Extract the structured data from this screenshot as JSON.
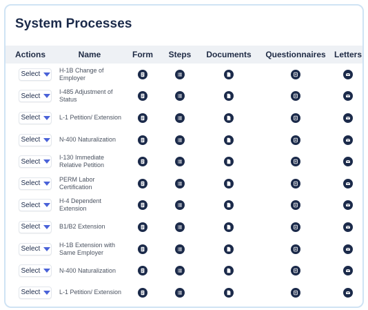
{
  "page": {
    "title": "System Processes"
  },
  "colors": {
    "accent": "#4a62d8",
    "icon_bg": "#1b2a4a",
    "header_bg": "#eef1f5",
    "border": "#cfe3f4"
  },
  "table": {
    "headers": {
      "actions": "Actions",
      "name": "Name",
      "form": "Form",
      "steps": "Steps",
      "documents": "Documents",
      "questionnaires": "Questionnaires",
      "letters": "Letters"
    },
    "row_icons": {
      "form": "form-icon",
      "steps": "list-icon",
      "documents": "document-icon",
      "questionnaires": "questionnaire-icon",
      "letters": "mail-icon"
    },
    "rows": [
      {
        "action": "Select",
        "name": "H-1B Change of Employer"
      },
      {
        "action": "Select",
        "name": "I-485 Adjustment of Status"
      },
      {
        "action": "Select",
        "name": "L-1 Petition/ Extension"
      },
      {
        "action": "Select",
        "name": "N-400 Naturalization"
      },
      {
        "action": "Select",
        "name": "I-130 Immediate Relative Petition"
      },
      {
        "action": "Select",
        "name": "PERM Labor Certification"
      },
      {
        "action": "Select",
        "name": "H-4 Dependent Extension"
      },
      {
        "action": "Select",
        "name": "B1/B2 Extension"
      },
      {
        "action": "Select",
        "name": "H-1B Extension with Same Employer"
      },
      {
        "action": "Select",
        "name": "N-400 Naturalization"
      },
      {
        "action": "Select",
        "name": "L-1 Petition/ Extension"
      }
    ]
  }
}
